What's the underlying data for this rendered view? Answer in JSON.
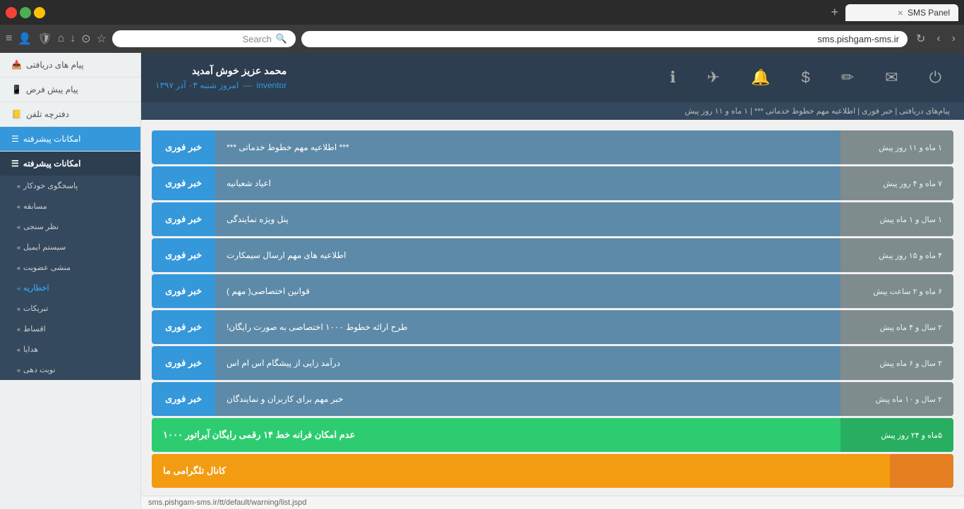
{
  "browser": {
    "tab_title": "SMS Panel",
    "url": "sms.pishgam-sms.ir",
    "search_placeholder": "Search",
    "search_value": ""
  },
  "topnav": {
    "user_name": "محمد عزیز خوش آمدید",
    "user_role": "inventor",
    "user_date": "امروز شنبه ۰۳ آذر ۱۳۹۷"
  },
  "info_bar": "پیام‌های دریافتی | خبر فوری | اطلاعیه مهم خطوط خدماتی *** | ۱ ماه و ۱۱ روز پیش",
  "sidebar": {
    "items": [
      {
        "label": "پیام های دریافتی",
        "icon": "📥",
        "active": false
      },
      {
        "label": "پیام پیش فرض",
        "icon": "📱",
        "active": false
      },
      {
        "label": "دفترچه تلفن",
        "icon": "📒",
        "active": false
      },
      {
        "label": "امکانات پیشرفته",
        "icon": "☰",
        "active": true
      }
    ],
    "sub_items": [
      {
        "label": "پاسخگوی خودکار",
        "active": false
      },
      {
        "label": "مسابقه",
        "active": false
      },
      {
        "label": "نظر سنجی",
        "active": false
      },
      {
        "label": "سیستم ایمیل",
        "active": false
      },
      {
        "label": "منشی عضویت",
        "active": false
      },
      {
        "label": "اخطاریه",
        "active": true
      },
      {
        "label": "تبریکات",
        "active": false
      },
      {
        "label": "اقساط",
        "active": false
      },
      {
        "label": "هدایا",
        "active": false
      },
      {
        "label": "نوبت دهی",
        "active": false
      }
    ]
  },
  "messages": [
    {
      "type": "خبر فوری",
      "content": "*** اطلاعیه مهم خطوط خدماتی ***",
      "date": "۱ ماه و ۱۱ روز پیش",
      "color": "blue"
    },
    {
      "type": "خبر فوری",
      "content": "اعیاد شعبانیه",
      "date": "۷ ماه و ۴ روز پیش",
      "color": "blue"
    },
    {
      "type": "خبر فوری",
      "content": "پنل ویژه نمایندگی",
      "date": "۱ سال و ۱ ماه پیش",
      "color": "blue"
    },
    {
      "type": "خبر فوری",
      "content": "اطلاعیه های مهم ارسال سیمکارت",
      "date": "۴ ماه و ۱۵ روز پیش",
      "color": "blue"
    },
    {
      "type": "خبر فوری",
      "content": "قوانین اختصاصی( مهم )",
      "date": "۶ ماه و ۲ ساعت پیش",
      "color": "blue"
    },
    {
      "type": "خبر فوری",
      "content": "طرح ارائه خطوط ۱۰۰۰ اختصاصی به صورت رایگان!",
      "date": "۲ سال و ۴ ماه پیش",
      "color": "blue"
    },
    {
      "type": "خبر فوری",
      "content": "درآمد زایی از پیشگام اس ام اس",
      "date": "۲ سال و ۶ ماه پیش",
      "color": "blue"
    },
    {
      "type": "خبر فوری",
      "content": "خبر مهم برای کاربران و نمایندگان",
      "date": "۲ سال و ۱۰ ماه پیش",
      "color": "blue"
    },
    {
      "type": "عدم امکان فرانه خط ۱۴ رقمی رایگان آیراتور ۱۰۰۰",
      "content": "",
      "date": "۵ماه و ۲۴ روز پیش",
      "color": "green"
    },
    {
      "type": "کانال تلگرامی ما",
      "content": "",
      "date": "",
      "color": "orange"
    }
  ],
  "status_bar": "sms.pishgam-sms.ir/tt/default/warning/list.jspd"
}
